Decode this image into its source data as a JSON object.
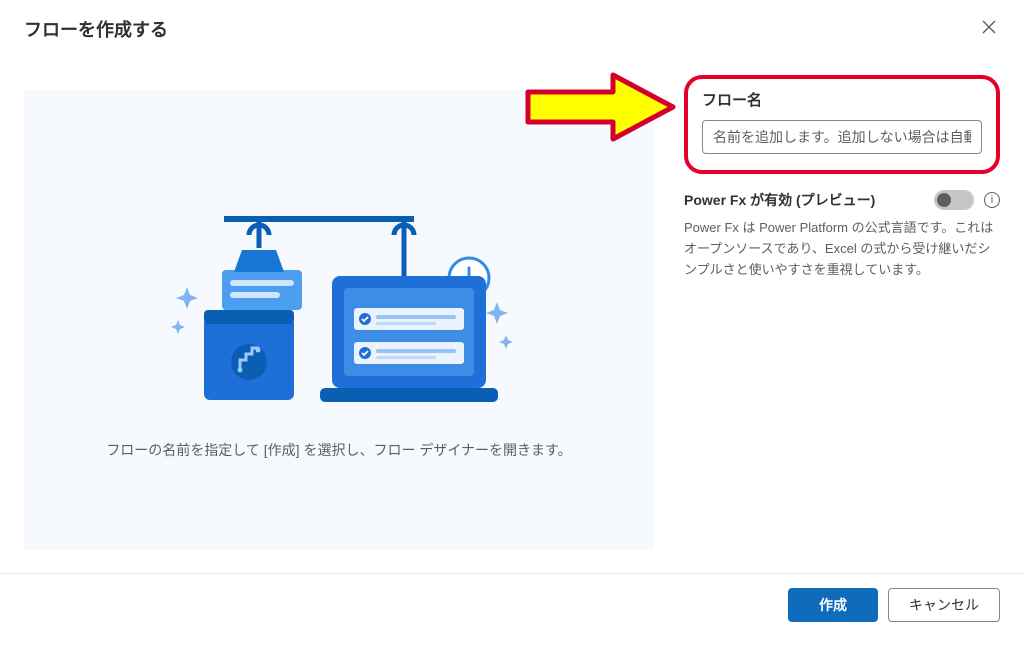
{
  "header": {
    "title": "フローを作成する"
  },
  "left": {
    "instruction": "フローの名前を指定して [作成] を選択し、フロー デザイナーを開きます。"
  },
  "right": {
    "flow_name_label": "フロー名",
    "flow_name_placeholder": "名前を追加します。追加しない場合は自動生成さ...",
    "powerfx_label": "Power Fx が有効 (プレビュー)",
    "powerfx_desc": "Power Fx は Power Platform の公式言語です。これはオープンソースであり、Excel の式から受け継いだシンプルさと使いやすさを重視しています。"
  },
  "footer": {
    "create": "作成",
    "cancel": "キャンセル"
  },
  "annotation": {
    "arrow": "yellow-arrow-right"
  }
}
